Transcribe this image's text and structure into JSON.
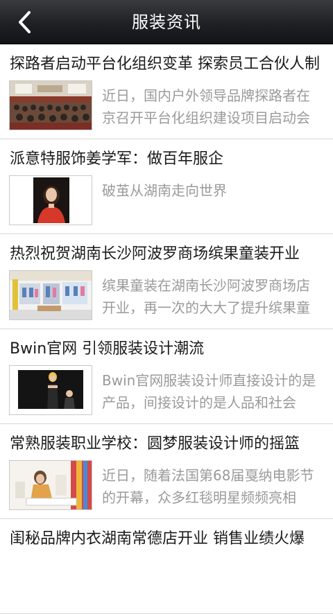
{
  "header": {
    "title": "服装资讯",
    "back_icon": "chevron-left-icon"
  },
  "articles": [
    {
      "title": "探路者启动平台化组织变革 探索员工合伙人制",
      "summary": "近日，国内户外领导品牌探路者在京召开平台化组织建设项目启动会",
      "thumb": "conference-hall-photo"
    },
    {
      "title": "派意特服饰姜学军：做百年服企",
      "summary": "破茧从湖南走向世界",
      "thumb": "woman-portrait-photo"
    },
    {
      "title": "热烈祝贺湖南长沙阿波罗商场缤果童装开业",
      "summary": "缤果童装在湖南长沙阿波罗商场店开业，再一次的大大了提升缤果童装的品牌形象",
      "thumb": "store-interior-photo"
    },
    {
      "title": "Bwin官网 引领服装设计潮流",
      "summary": "Bwin官网服装设计师直接设计的是产品，间接设计的是人品和社会",
      "thumb": "bwin-banner-photo"
    },
    {
      "title": "常熟服装职业学校：圆梦服装设计师的摇篮",
      "summary": "近日，随着法国第68届戛纳电影节的开幕，众多红毯明星频频亮相",
      "thumb": "designer-sketching-photo"
    },
    {
      "title": "闺秘品牌内衣湖南常德店开业 销售业绩火爆",
      "summary": "",
      "thumb": ""
    }
  ]
}
